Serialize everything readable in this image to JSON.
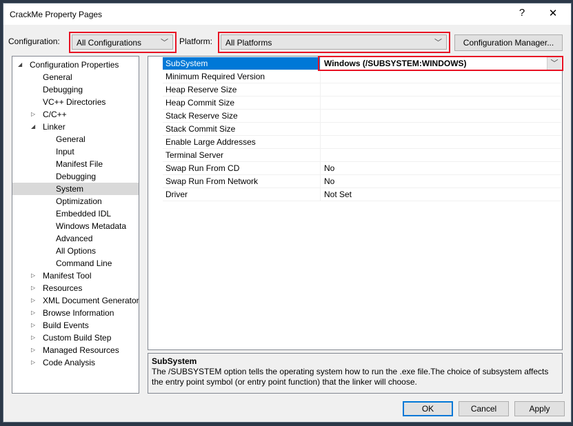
{
  "window": {
    "title": "CrackMe Property Pages",
    "help_label": "?",
    "close_label": "✕"
  },
  "toolbar": {
    "configuration_label": "Configuration:",
    "configuration_value": "All Configurations",
    "platform_label": "Platform:",
    "platform_value": "All Platforms",
    "config_manager_label": "Configuration Manager..."
  },
  "tree": [
    {
      "label": "Configuration Properties",
      "level": 0,
      "arrow": "expanded"
    },
    {
      "label": "General",
      "level": 1
    },
    {
      "label": "Debugging",
      "level": 1
    },
    {
      "label": "VC++ Directories",
      "level": 1
    },
    {
      "label": "C/C++",
      "level": 1,
      "arrow": "collapsed"
    },
    {
      "label": "Linker",
      "level": 1,
      "arrow": "expanded"
    },
    {
      "label": "General",
      "level": 2
    },
    {
      "label": "Input",
      "level": 2
    },
    {
      "label": "Manifest File",
      "level": 2
    },
    {
      "label": "Debugging",
      "level": 2
    },
    {
      "label": "System",
      "level": 2,
      "selected": true
    },
    {
      "label": "Optimization",
      "level": 2
    },
    {
      "label": "Embedded IDL",
      "level": 2
    },
    {
      "label": "Windows Metadata",
      "level": 2
    },
    {
      "label": "Advanced",
      "level": 2
    },
    {
      "label": "All Options",
      "level": 2
    },
    {
      "label": "Command Line",
      "level": 2
    },
    {
      "label": "Manifest Tool",
      "level": 1,
      "arrow": "collapsed"
    },
    {
      "label": "Resources",
      "level": 1,
      "arrow": "collapsed"
    },
    {
      "label": "XML Document Generator",
      "level": 1,
      "arrow": "collapsed"
    },
    {
      "label": "Browse Information",
      "level": 1,
      "arrow": "collapsed"
    },
    {
      "label": "Build Events",
      "level": 1,
      "arrow": "collapsed"
    },
    {
      "label": "Custom Build Step",
      "level": 1,
      "arrow": "collapsed"
    },
    {
      "label": "Managed Resources",
      "level": 1,
      "arrow": "collapsed"
    },
    {
      "label": "Code Analysis",
      "level": 1,
      "arrow": "collapsed"
    }
  ],
  "properties": [
    {
      "name": "SubSystem",
      "value": "Windows (/SUBSYSTEM:WINDOWS)",
      "selected": true
    },
    {
      "name": "Minimum Required Version",
      "value": ""
    },
    {
      "name": "Heap Reserve Size",
      "value": ""
    },
    {
      "name": "Heap Commit Size",
      "value": ""
    },
    {
      "name": "Stack Reserve Size",
      "value": ""
    },
    {
      "name": "Stack Commit Size",
      "value": ""
    },
    {
      "name": "Enable Large Addresses",
      "value": ""
    },
    {
      "name": "Terminal Server",
      "value": ""
    },
    {
      "name": "Swap Run From CD",
      "value": "No"
    },
    {
      "name": "Swap Run From Network",
      "value": "No"
    },
    {
      "name": "Driver",
      "value": "Not Set"
    }
  ],
  "description": {
    "title": "SubSystem",
    "text": "The /SUBSYSTEM option tells the operating system how to run the .exe file.The choice of subsystem affects the entry point symbol (or entry point function) that the linker will choose."
  },
  "buttons": {
    "ok": "OK",
    "cancel": "Cancel",
    "apply": "Apply"
  },
  "colors": {
    "highlight": "#0078d7",
    "annotation": "#e81123"
  }
}
